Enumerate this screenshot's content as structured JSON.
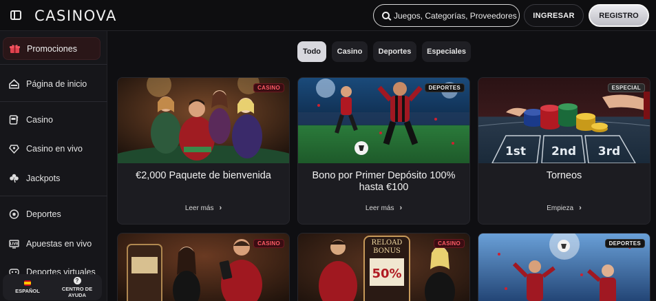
{
  "header": {
    "logo": "CASINOVA",
    "search_placeholder": "Juegos, Categorías, Proveedores",
    "login_label": "INGRESAR",
    "register_label": "REGISTRO"
  },
  "sidebar": {
    "items": [
      {
        "label": "Promociones",
        "icon": "gift-icon"
      },
      {
        "label": "Página de inicio",
        "icon": "home-icon"
      },
      {
        "label": "Casino",
        "icon": "slot-machine-icon"
      },
      {
        "label": "Casino en vivo",
        "icon": "live-casino-icon"
      },
      {
        "label": "Jackpots",
        "icon": "clover-icon"
      },
      {
        "label": "Deportes",
        "icon": "soccer-ball-icon"
      },
      {
        "label": "Apuestas en vivo",
        "icon": "live-tv-icon"
      },
      {
        "label": "Deportes virtuales",
        "icon": "virtual-sports-icon"
      }
    ],
    "language": "ESPAÑOL",
    "help": "CENTRO DE AYUDA"
  },
  "tabs": [
    "Todo",
    "Casino",
    "Deportes",
    "Especiales"
  ],
  "active_tab": "Todo",
  "cards": [
    {
      "badge": "CASINO",
      "title": "€2,000 Paquete de bienvenida",
      "link": "Leer más"
    },
    {
      "badge": "DEPORTES",
      "title": "Bono por Primer Depósito 100% hasta €100",
      "link": "Leer más"
    },
    {
      "badge": "ESPECIAL",
      "title": "Torneos",
      "link": "Empieza",
      "image_text": [
        "1st",
        "2nd",
        "3rd"
      ]
    },
    {
      "badge": "CASINO"
    },
    {
      "badge": "CASINO",
      "image_text": [
        "RELOAD",
        "BONUS",
        "50%"
      ]
    },
    {
      "badge": "DEPORTES"
    }
  ],
  "colors": {
    "background": "#0f0f12",
    "sidebar": "#16161a",
    "casino_badge": "#ff5c66",
    "active_tab": "#d8d8de"
  }
}
